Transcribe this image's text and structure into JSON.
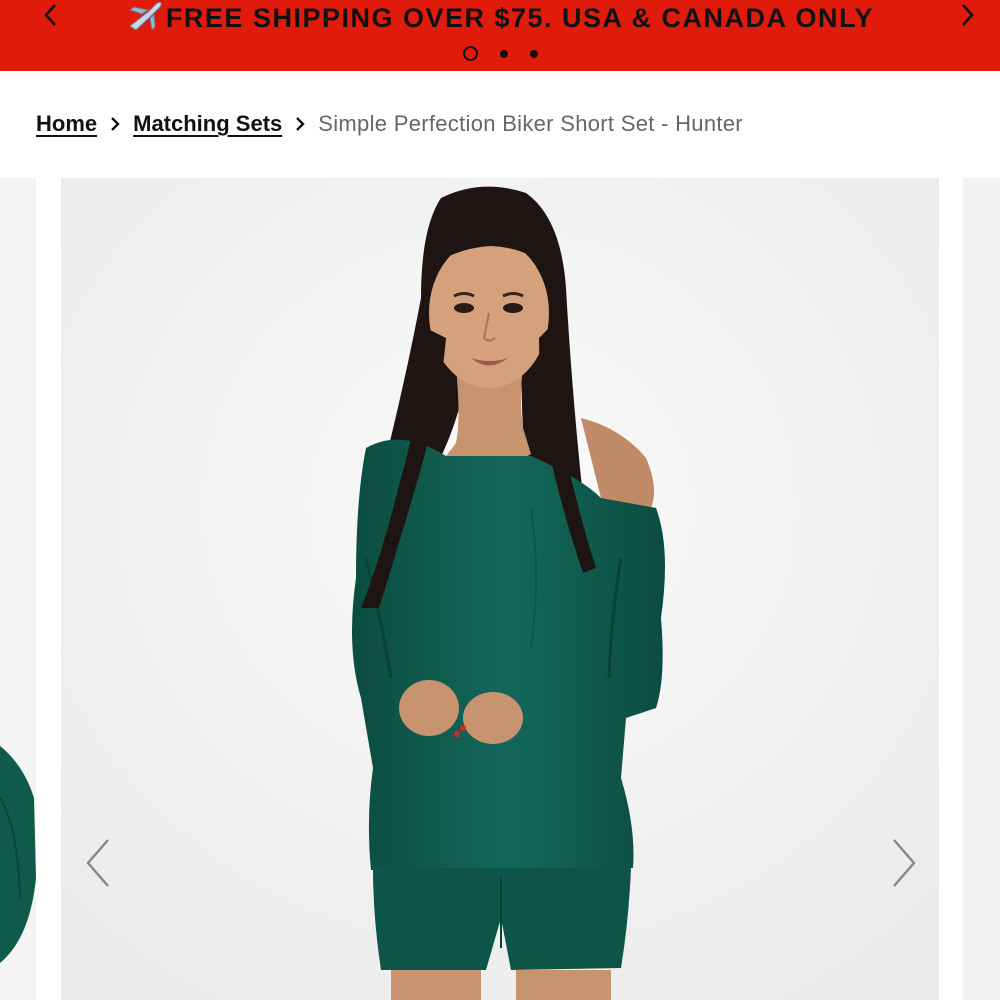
{
  "promo": {
    "message": "FREE SHIPPING OVER $75. USA & CANADA ONLY",
    "icon": "airplane-icon",
    "slides": 3,
    "active_slide": 1,
    "background_color": "#e11b0c"
  },
  "breadcrumb": {
    "home": "Home",
    "category": "Matching Sets",
    "current": "Simple Perfection Biker Short Set - Hunter"
  },
  "gallery": {
    "prev_icon": "chevron-left-icon",
    "next_icon": "chevron-right-icon",
    "product_color": "#0f5a4b"
  }
}
